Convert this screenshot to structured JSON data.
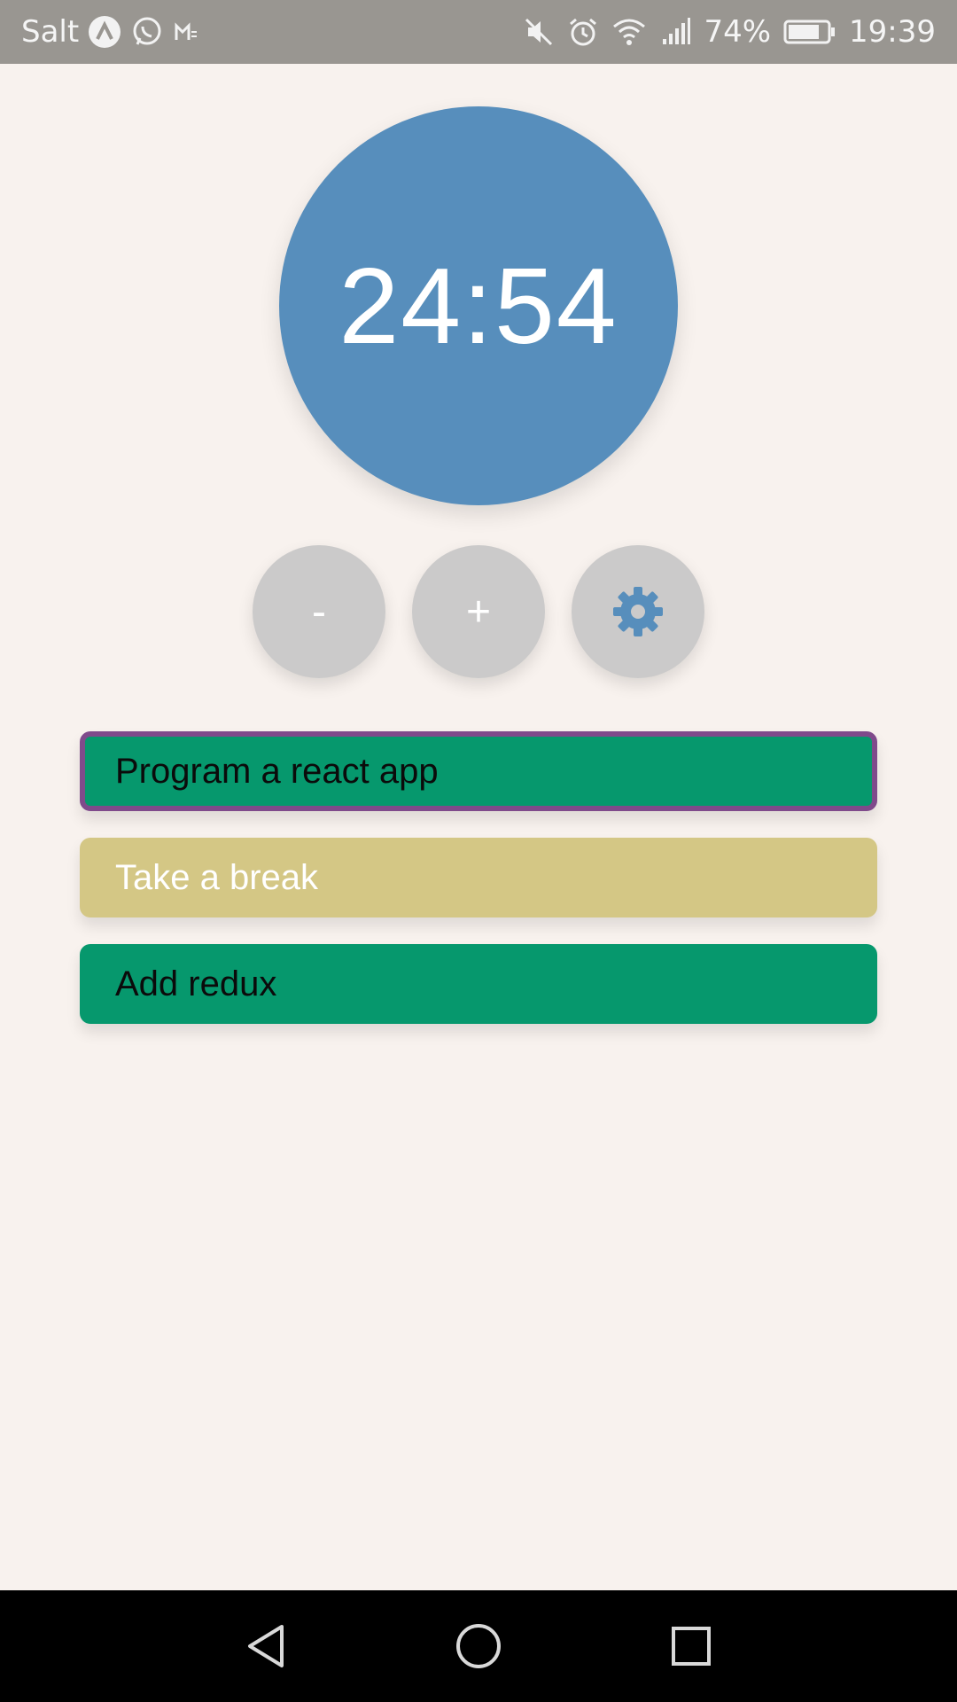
{
  "status_bar": {
    "carrier": "Salt",
    "battery_percent": "74%",
    "time": "19:39",
    "icons_left": [
      "nova-launcher-icon",
      "whatsapp-icon",
      "gmail-icon"
    ],
    "icons_right": [
      "mute-icon",
      "alarm-icon",
      "wifi-icon",
      "signal-icon",
      "battery-icon"
    ]
  },
  "timer": {
    "value": "24:54",
    "color": "#578ebc"
  },
  "controls": {
    "decrease_label": "-",
    "increase_label": "+",
    "settings_icon": "gear-icon"
  },
  "tasks": [
    {
      "label": "Program a react app",
      "color": "#06986d",
      "selected": true
    },
    {
      "label": "Take a break",
      "color": "#d4c785",
      "selected": false
    },
    {
      "label": "Add redux",
      "color": "#06986d",
      "selected": false
    }
  ],
  "nav_bar": {
    "icons": [
      "back-icon",
      "home-icon",
      "recent-apps-icon"
    ]
  }
}
